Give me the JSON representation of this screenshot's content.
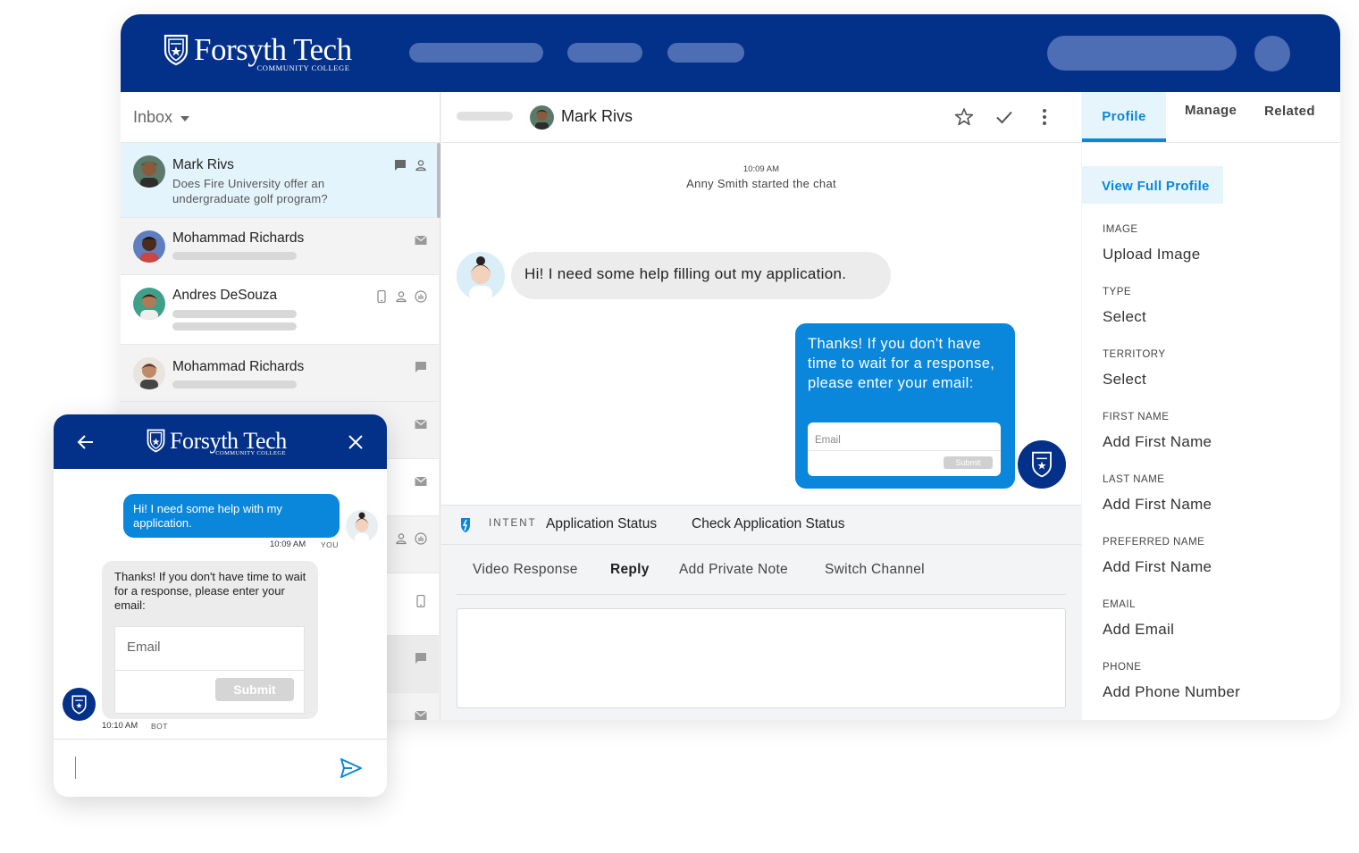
{
  "brand": {
    "name": "Forsyth Tech",
    "sub": "COMMUNITY COLLEGE"
  },
  "inbox": {
    "title": "Inbox",
    "conversations": [
      {
        "name": "Mark Rivs",
        "preview": "Does Fire University offer an undergraduate golf program?"
      },
      {
        "name": "Mohammad Richards"
      },
      {
        "name": "Andres DeSouza"
      },
      {
        "name": "Mohammad Richards"
      }
    ]
  },
  "chat": {
    "contact": "Mark Rivs",
    "timestamp": "10:09 AM",
    "system_message": "Anny Smith started the chat",
    "incoming_message": "Hi! I need some help filling out my application.",
    "outgoing_message": "Thanks! If you don't have time to wait for a response, please enter your email:",
    "email_placeholder": "Email",
    "submit_label": "Submit",
    "intent_label": "INTENT",
    "intent_value": "Application Status",
    "intent_action": "Check Application Status",
    "composer_tabs": [
      "Video Response",
      "Reply",
      "Add Private Note",
      "Switch Channel"
    ]
  },
  "profile": {
    "tabs": [
      "Profile",
      "Manage",
      "Related"
    ],
    "view_full_profile": "View Full Profile",
    "fields": [
      {
        "label": "IMAGE",
        "value": "Upload Image"
      },
      {
        "label": "TYPE",
        "value": "Select"
      },
      {
        "label": "TERRITORY",
        "value": "Select"
      },
      {
        "label": "FIRST NAME",
        "value": "Add First Name"
      },
      {
        "label": "LAST NAME",
        "value": "Add First Name"
      },
      {
        "label": "PREFERRED NAME",
        "value": "Add First Name"
      },
      {
        "label": "EMAIL",
        "value": "Add Email"
      },
      {
        "label": "PHONE",
        "value": "Add Phone Number"
      }
    ]
  },
  "widget": {
    "user_message": "Hi! I need some help with my application.",
    "user_time": "10:09 AM",
    "user_tag": "YOU",
    "bot_message": "Thanks! If you don't have time to wait for a response, please enter your email:",
    "email_placeholder": "Email",
    "submit_label": "Submit",
    "bot_time": "10:10 AM",
    "bot_tag": "BOT"
  },
  "colors": {
    "brand_navy": "#033088",
    "accent_blue": "#0a86db",
    "tab_highlight": "#e6f5fc"
  }
}
